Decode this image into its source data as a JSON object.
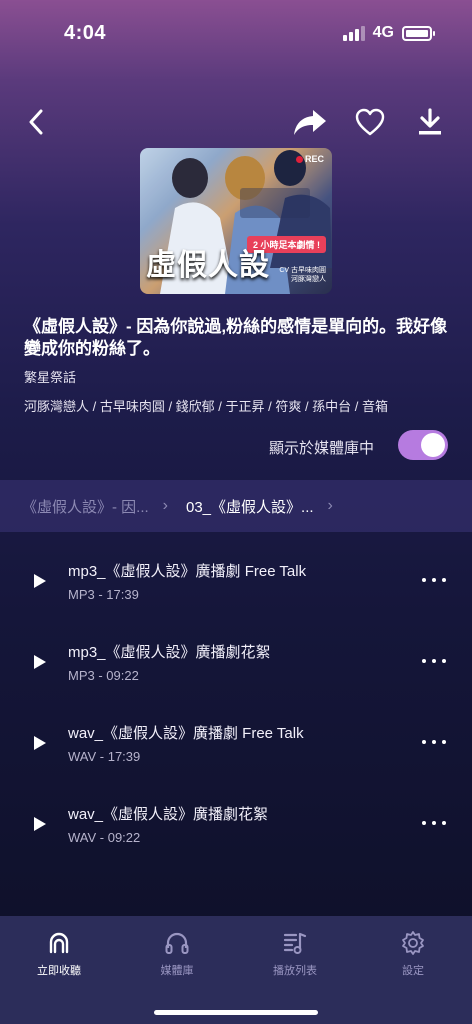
{
  "status_bar": {
    "time": "4:04",
    "network": "4G"
  },
  "album": {
    "cover_title": "虛假人設",
    "cover_rec": "REC",
    "cover_banner": "2 小時足本劇情 !",
    "cover_cv_line1": "CV 古早味肉圓",
    "cover_cv_line2": "河豚灣戀人",
    "title": "《虛假人設》- 因為你說過,粉絲的感情是單向的。我好像變成你的粉絲了。",
    "circle": "繁星祭話",
    "cast": "河豚灣戀人 / 古早味肉圓 / 錢欣郁 / 于正昇 / 符爽 / 孫中台 / 音箱",
    "toggle_label": "顯示於媒體庫中",
    "toggle_on": true
  },
  "breadcrumb": {
    "parent": "《虛假人設》- 因...",
    "current": "03_《虛假人設》..."
  },
  "tracks": [
    {
      "name": "mp3_《虛假人設》廣播劇 Free Talk",
      "meta": "MP3 - 17:39"
    },
    {
      "name": "mp3_《虛假人設》廣播劇花絮",
      "meta": "MP3 - 09:22"
    },
    {
      "name": "wav_《虛假人設》廣播劇 Free Talk",
      "meta": "WAV - 17:39"
    },
    {
      "name": "wav_《虛假人設》廣播劇花絮",
      "meta": "WAV - 09:22"
    }
  ],
  "tabbar": {
    "tabs": [
      {
        "label": "立即收聽",
        "icon": "listen-now-icon"
      },
      {
        "label": "媒體庫",
        "icon": "headphones-icon"
      },
      {
        "label": "播放列表",
        "icon": "playlist-icon"
      },
      {
        "label": "設定",
        "icon": "gear-icon"
      }
    ]
  },
  "colors": {
    "accent": "#b67be0",
    "tabbar_bg": "#2c2d5a"
  }
}
